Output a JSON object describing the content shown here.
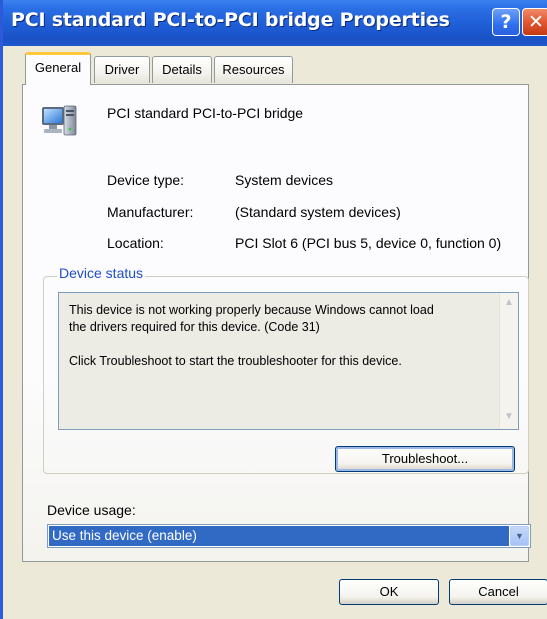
{
  "window": {
    "title": "PCI standard PCI-to-PCI bridge Properties",
    "help_glyph": "?",
    "close_glyph": "✕"
  },
  "tabs": [
    {
      "label": "General",
      "active": true
    },
    {
      "label": "Driver",
      "active": false
    },
    {
      "label": "Details",
      "active": false
    },
    {
      "label": "Resources",
      "active": false
    }
  ],
  "device": {
    "name": "PCI standard PCI-to-PCI bridge",
    "icon": "computer-device-icon",
    "properties": [
      {
        "label": "Device type:",
        "value": "System devices"
      },
      {
        "label": "Manufacturer:",
        "value": "(Standard system devices)"
      },
      {
        "label": "Location:",
        "value": "PCI Slot 6 (PCI bus 5, device 0, function 0)"
      }
    ]
  },
  "device_status": {
    "title": "Device status",
    "lines": [
      "This device is not working properly because Windows cannot load",
      "the drivers required for this device. (Code 31)",
      "Click Troubleshoot to start the troubleshooter for this device."
    ],
    "scroll_up_glyph": "▲",
    "scroll_down_glyph": "▼"
  },
  "troubleshoot_label": "Troubleshoot...",
  "device_usage": {
    "label": "Device usage:",
    "selected": "Use this device (enable)",
    "arrow_glyph": "▼"
  },
  "footer": {
    "ok_label": "OK",
    "cancel_label": "Cancel"
  },
  "colors": {
    "titlebar": "#1f5dd6",
    "tab_highlight": "#ffc83c",
    "selection": "#316ac5",
    "group_title": "#1f4fc8"
  }
}
